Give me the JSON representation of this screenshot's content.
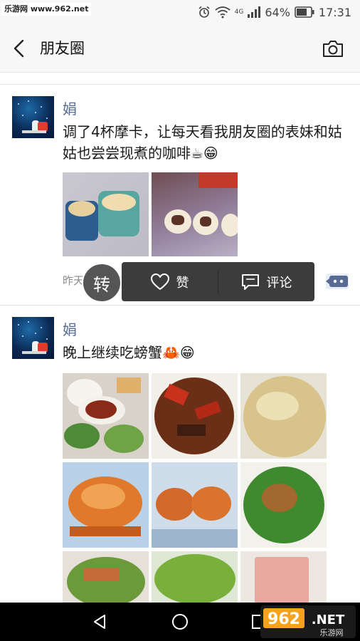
{
  "status_bar": {
    "site_label": "乐游网 www.962.net",
    "battery_percent": "64%",
    "time": "17:31",
    "network_label": "4G"
  },
  "nav": {
    "title": "朋友圈"
  },
  "posts": [
    {
      "author": "娟",
      "text": "调了4杯摩卡，让每天看我朋友圈的表妹和姑姑也尝尝现煮的咖啡☕😁",
      "time": "昨天"
    },
    {
      "author": "娟",
      "text": "晚上继续吃螃蟹🦀😁"
    }
  ],
  "actions": {
    "like_label": "赞",
    "comment_label": "评论",
    "repost_label": "转"
  },
  "watermark": {
    "brand": "962.NET",
    "subtitle": "乐游网"
  },
  "colors": {
    "author_name": "#576b95",
    "popup_bg": "#3c3c3c"
  }
}
